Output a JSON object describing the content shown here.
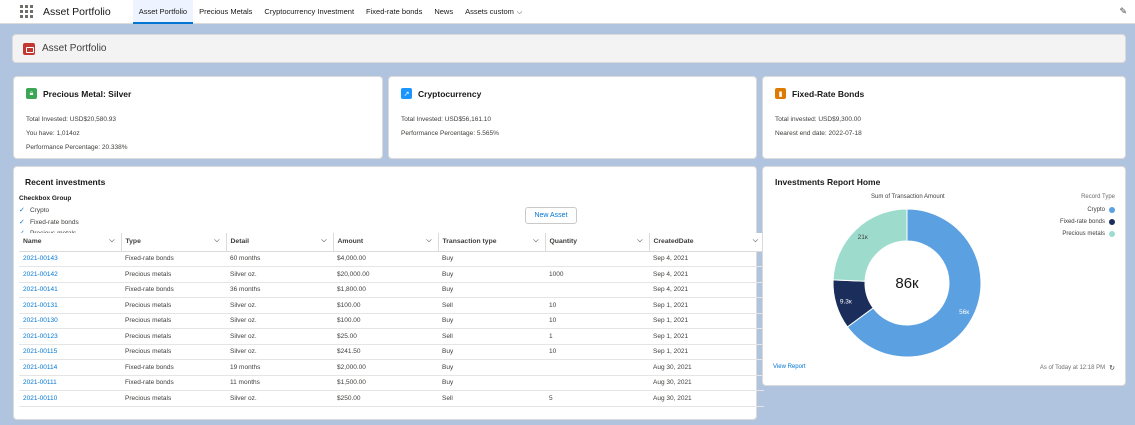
{
  "app": {
    "name": "Asset Portfolio"
  },
  "nav": {
    "tabs": [
      {
        "label": "Asset Portfolio",
        "active": true
      },
      {
        "label": "Precious Metals",
        "active": false
      },
      {
        "label": "Cryptocurrency Investment",
        "active": false
      },
      {
        "label": "Fixed-rate bonds",
        "active": false
      },
      {
        "label": "News",
        "active": false
      },
      {
        "label": "Assets custom",
        "active": false
      }
    ]
  },
  "page_header": {
    "title": "Asset Portfolio"
  },
  "cards": {
    "silver": {
      "title": "Precious Metal: Silver",
      "icon": "lock-icon",
      "color": "#3ba755",
      "lines": [
        "Total Invested: USD$20,580.93",
        "You have: 1,014oz",
        "Performance Percentage: 20.338%"
      ]
    },
    "crypto": {
      "title": "Cryptocurrency",
      "icon": "trend-icon",
      "color": "#1b96ff",
      "lines": [
        "Total Invested: USD$56,161.10",
        "Performance Percentage: 5.565%"
      ]
    },
    "bonds": {
      "title": "Fixed-Rate Bonds",
      "icon": "bar-chart-icon",
      "color": "#dd7a01",
      "lines": [
        "Total invested: USD$9,300.00",
        "Nearest end date: 2022-07-18"
      ]
    }
  },
  "recent": {
    "title": "Recent investments",
    "checkbox_group": {
      "label": "Checkbox Group",
      "items": [
        "Crypto",
        "Fixed-rate bonds",
        "Precious metals"
      ]
    },
    "new_button": "New Asset",
    "columns": [
      "Name",
      "Type",
      "Detail",
      "Amount",
      "Transaction type",
      "Quantity",
      "CreatedDate"
    ],
    "rows": [
      [
        "2021-00143",
        "Fixed-rate bonds",
        "60 months",
        "$4,000.00",
        "Buy",
        "",
        "Sep 4, 2021"
      ],
      [
        "2021-00142",
        "Precious metals",
        "Silver oz.",
        "$20,000.00",
        "Buy",
        "1000",
        "Sep 4, 2021"
      ],
      [
        "2021-00141",
        "Fixed-rate bonds",
        "36 months",
        "$1,800.00",
        "Buy",
        "",
        "Sep 4, 2021"
      ],
      [
        "2021-00131",
        "Precious metals",
        "Silver oz.",
        "$100.00",
        "Sell",
        "10",
        "Sep 1, 2021"
      ],
      [
        "2021-00130",
        "Precious metals",
        "Silver oz.",
        "$100.00",
        "Buy",
        "10",
        "Sep 1, 2021"
      ],
      [
        "2021-00123",
        "Precious metals",
        "Silver oz.",
        "$25.00",
        "Sell",
        "1",
        "Sep 1, 2021"
      ],
      [
        "2021-00115",
        "Precious metals",
        "Silver oz.",
        "$241.50",
        "Buy",
        "10",
        "Sep 1, 2021"
      ],
      [
        "2021-00114",
        "Fixed-rate bonds",
        "19 months",
        "$2,000.00",
        "Buy",
        "",
        "Aug 30, 2021"
      ],
      [
        "2021-00111",
        "Fixed-rate bonds",
        "11 months",
        "$1,500.00",
        "Buy",
        "",
        "Aug 30, 2021"
      ],
      [
        "2021-00110",
        "Precious metals",
        "Silver oz.",
        "$250.00",
        "Sell",
        "5",
        "Aug 30, 2021"
      ]
    ]
  },
  "report": {
    "title": "Investments Report Home",
    "view_report": "View Report",
    "as_of": "As of Today at 12:18 PM"
  },
  "chart_data": {
    "type": "pie",
    "title": "Sum of Transaction Amount",
    "center_label": "86к",
    "legend_title": "Record Type",
    "categories": [
      "Crypto",
      "Fixed-rate bonds",
      "Precious metals"
    ],
    "values": [
      56,
      9.3,
      21
    ],
    "labels": [
      "56к",
      "9.3к",
      "21к"
    ],
    "colors": [
      "#5ba0e0",
      "#1b2d5a",
      "#9ddccd"
    ]
  }
}
